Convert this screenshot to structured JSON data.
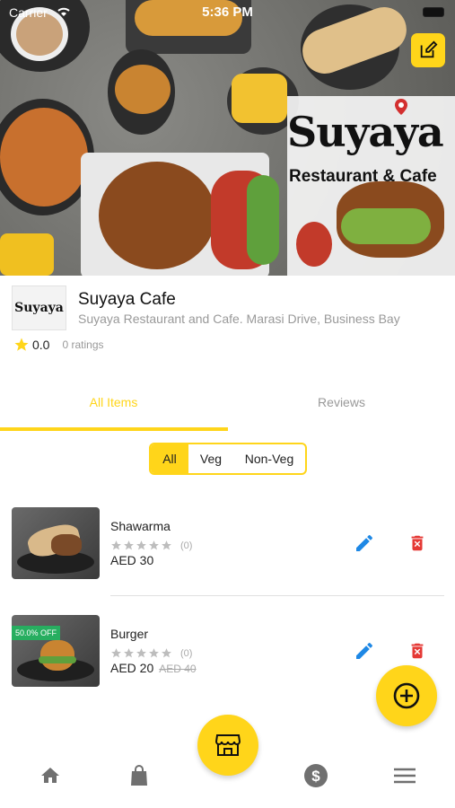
{
  "status_bar": {
    "carrier": "Carrier",
    "time": "5:36 PM"
  },
  "brand": {
    "title": "Suyaya",
    "subtitle": "Restaurant & Cafe"
  },
  "store": {
    "logo_text": "Suyaya",
    "name": "Suyaya Cafe",
    "address": "Suyaya Restaurant and Cafe. Marasi Drive, Business Bay",
    "rating": "0.0",
    "ratings_count": "0 ratings"
  },
  "tabs": [
    {
      "label": "All Items",
      "active": true
    },
    {
      "label": "Reviews",
      "active": false
    }
  ],
  "filter": {
    "options": [
      "All",
      "Veg",
      "Non-Veg"
    ],
    "selected": "All"
  },
  "items": [
    {
      "name": "Shawarma",
      "rating_count": "(0)",
      "price": "AED 30",
      "old_price": "",
      "badge": ""
    },
    {
      "name": "Burger",
      "rating_count": "(0)",
      "price": "AED 20",
      "old_price": "AED 40",
      "badge": "50.0% OFF"
    }
  ],
  "bottom_nav": [
    "home-icon",
    "shopping-bag-icon",
    "store-icon",
    "dollar-icon",
    "menu-icon"
  ],
  "colors": {
    "accent": "#ffd51a",
    "edit_blue": "#1e88e5",
    "delete_red": "#e53935",
    "badge_green": "#27ae60"
  }
}
